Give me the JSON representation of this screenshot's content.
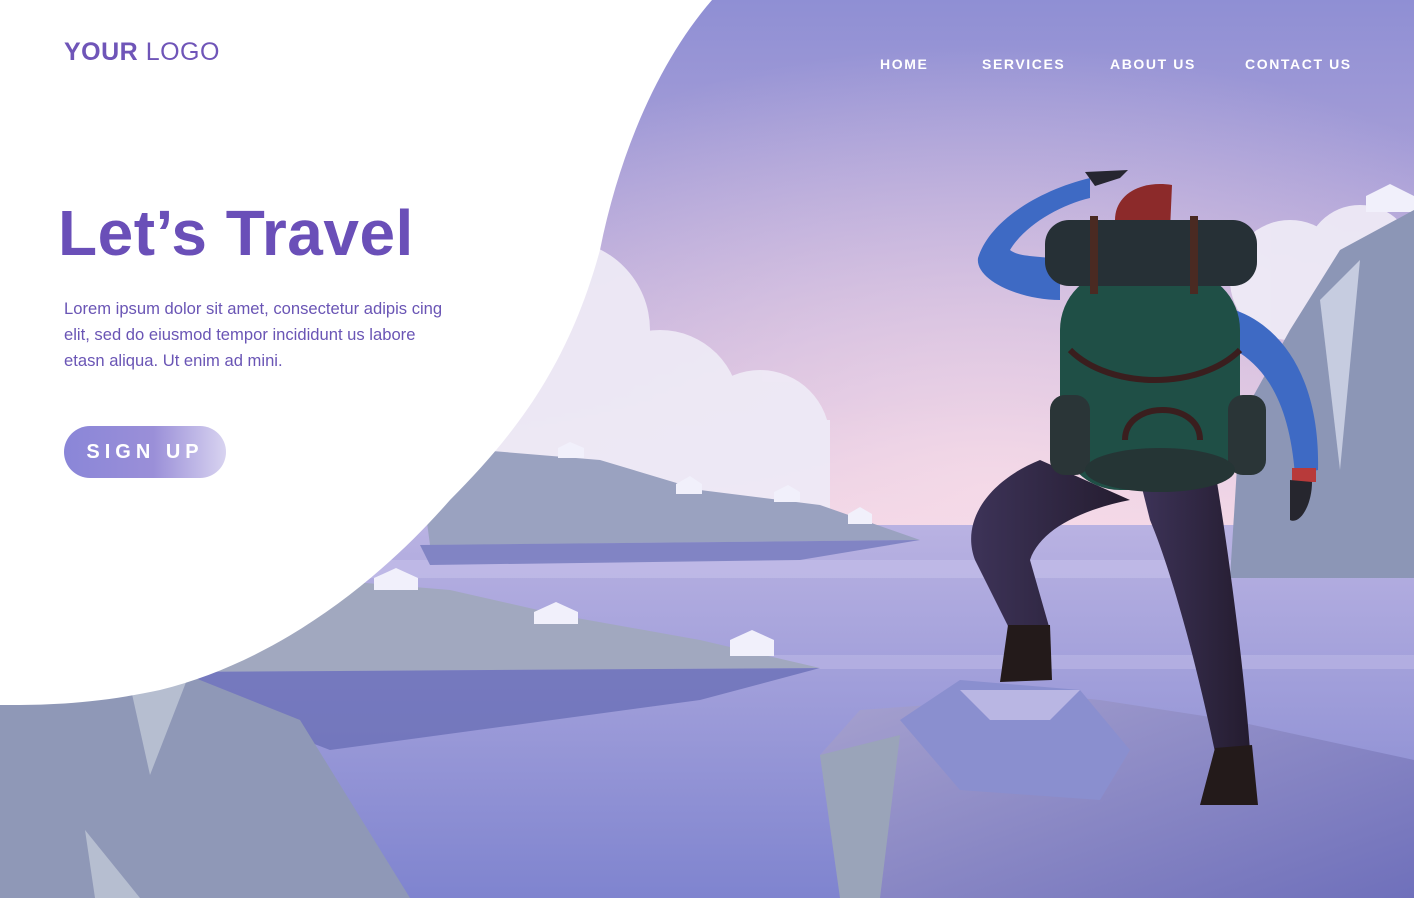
{
  "brand": {
    "logo_bold": "YOUR",
    "logo_light": "LOGO"
  },
  "nav": {
    "items": [
      {
        "label": "HOME"
      },
      {
        "label": "SERVICES"
      },
      {
        "label": "ABOUT US"
      },
      {
        "label": "CONTACT US"
      }
    ]
  },
  "hero": {
    "title": "Let’s Travel",
    "description": "Lorem ipsum dolor sit amet, consectetur adipis cing elit, sed do eiusmod tempor incididunt us labore etasn aliqua. Ut enim ad mini.",
    "cta_label": "SIGN UP"
  },
  "illustration": {
    "subject": "hiker with backpack looking over a lake with mountains and houses",
    "sky_top": "#8f8fd4",
    "sky_glow": "#f3d6e6",
    "water": "#8d8fd6",
    "backpack": "#1f4f46",
    "jacket": "#3e6ac4",
    "pants": "#2a2238",
    "hat": "#8c2a2a",
    "accent": "#6a4fb8"
  }
}
